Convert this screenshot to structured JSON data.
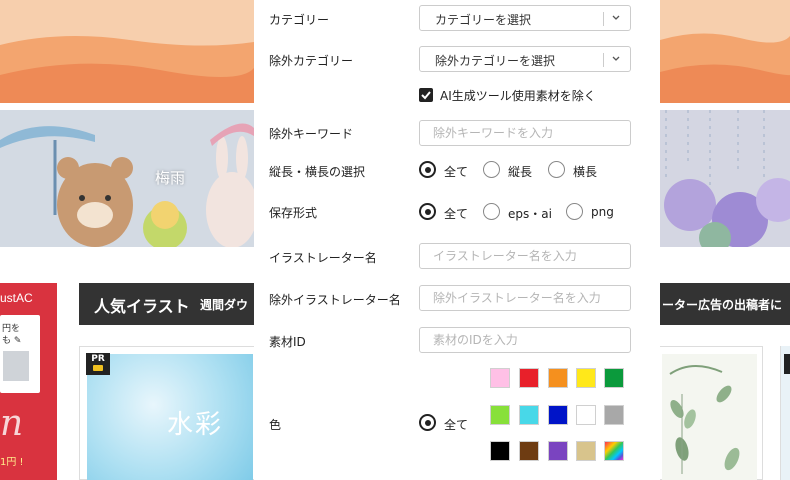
{
  "background": {
    "banner_title": "梅雨",
    "ad_brand": "ustAC",
    "ad_card_text": [
      "円を",
      "も ✎"
    ],
    "ad_swirl": "n",
    "ad_tag": "1円 !",
    "popular_title": "人気イラスト",
    "popular_sub": "週間ダウ",
    "popular_right": "ーター広告の出稿者に",
    "pr_badge": "PR",
    "card_title": "水彩"
  },
  "form": {
    "category": {
      "label": "カテゴリー",
      "selected": "カテゴリーを選択"
    },
    "exclude_category": {
      "label": "除外カテゴリー",
      "selected": "除外カテゴリーを選択"
    },
    "ai_exclude": {
      "label": "AI生成ツール使用素材を除く",
      "checked": true
    },
    "exclude_keyword": {
      "label": "除外キーワード",
      "placeholder": "除外キーワードを入力"
    },
    "orientation": {
      "label": "縦長・横長の選択",
      "options": [
        "全て",
        "縦長",
        "横長"
      ],
      "selected": "全て"
    },
    "format": {
      "label": "保存形式",
      "options": [
        "全て",
        "eps・ai",
        "png"
      ],
      "selected": "全て"
    },
    "illustrator": {
      "label": "イラストレーター名",
      "placeholder": "イラストレーター名を入力"
    },
    "exclude_illustrator": {
      "label": "除外イラストレーター名",
      "placeholder": "除外イラストレーター名を入力"
    },
    "material_id": {
      "label": "素材ID",
      "placeholder": "素材のIDを入力"
    },
    "color": {
      "label": "色",
      "all_label": "全て",
      "selected": "全て",
      "swatches": [
        "#ffc0e6",
        "#e8202a",
        "#f5901e",
        "#ffe81a",
        "#0b9a3c",
        "#88e03a",
        "#48d8e8",
        "#0014c8",
        "#ffffff",
        "#a8a8a8",
        "#000000",
        "#6e3c12",
        "#7a44c0",
        "#d8c48c",
        "rainbow"
      ]
    }
  }
}
